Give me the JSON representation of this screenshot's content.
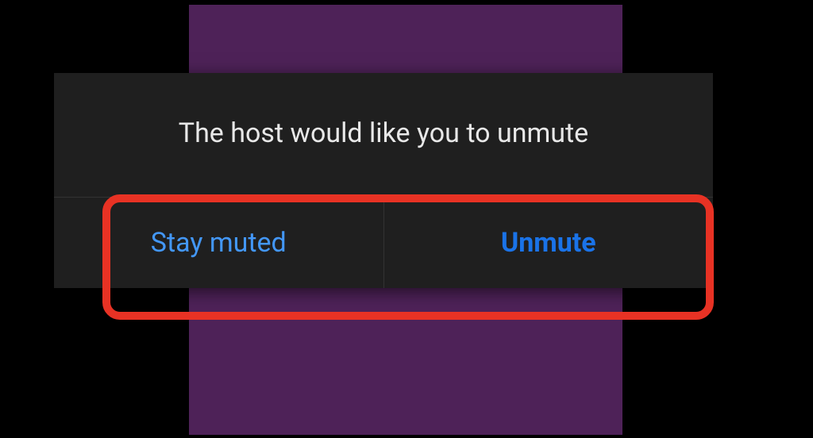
{
  "dialog": {
    "message": "The host would like you to unmute",
    "buttons": {
      "stay_muted": "Stay muted",
      "unmute": "Unmute"
    }
  },
  "colors": {
    "background": "#000000",
    "backdrop": "#4e2258",
    "dialog_bg": "#1f1f1f",
    "text": "#e8e8e8",
    "link": "#4397f7",
    "link_bold": "#1a73e8",
    "highlight": "#e83224"
  }
}
